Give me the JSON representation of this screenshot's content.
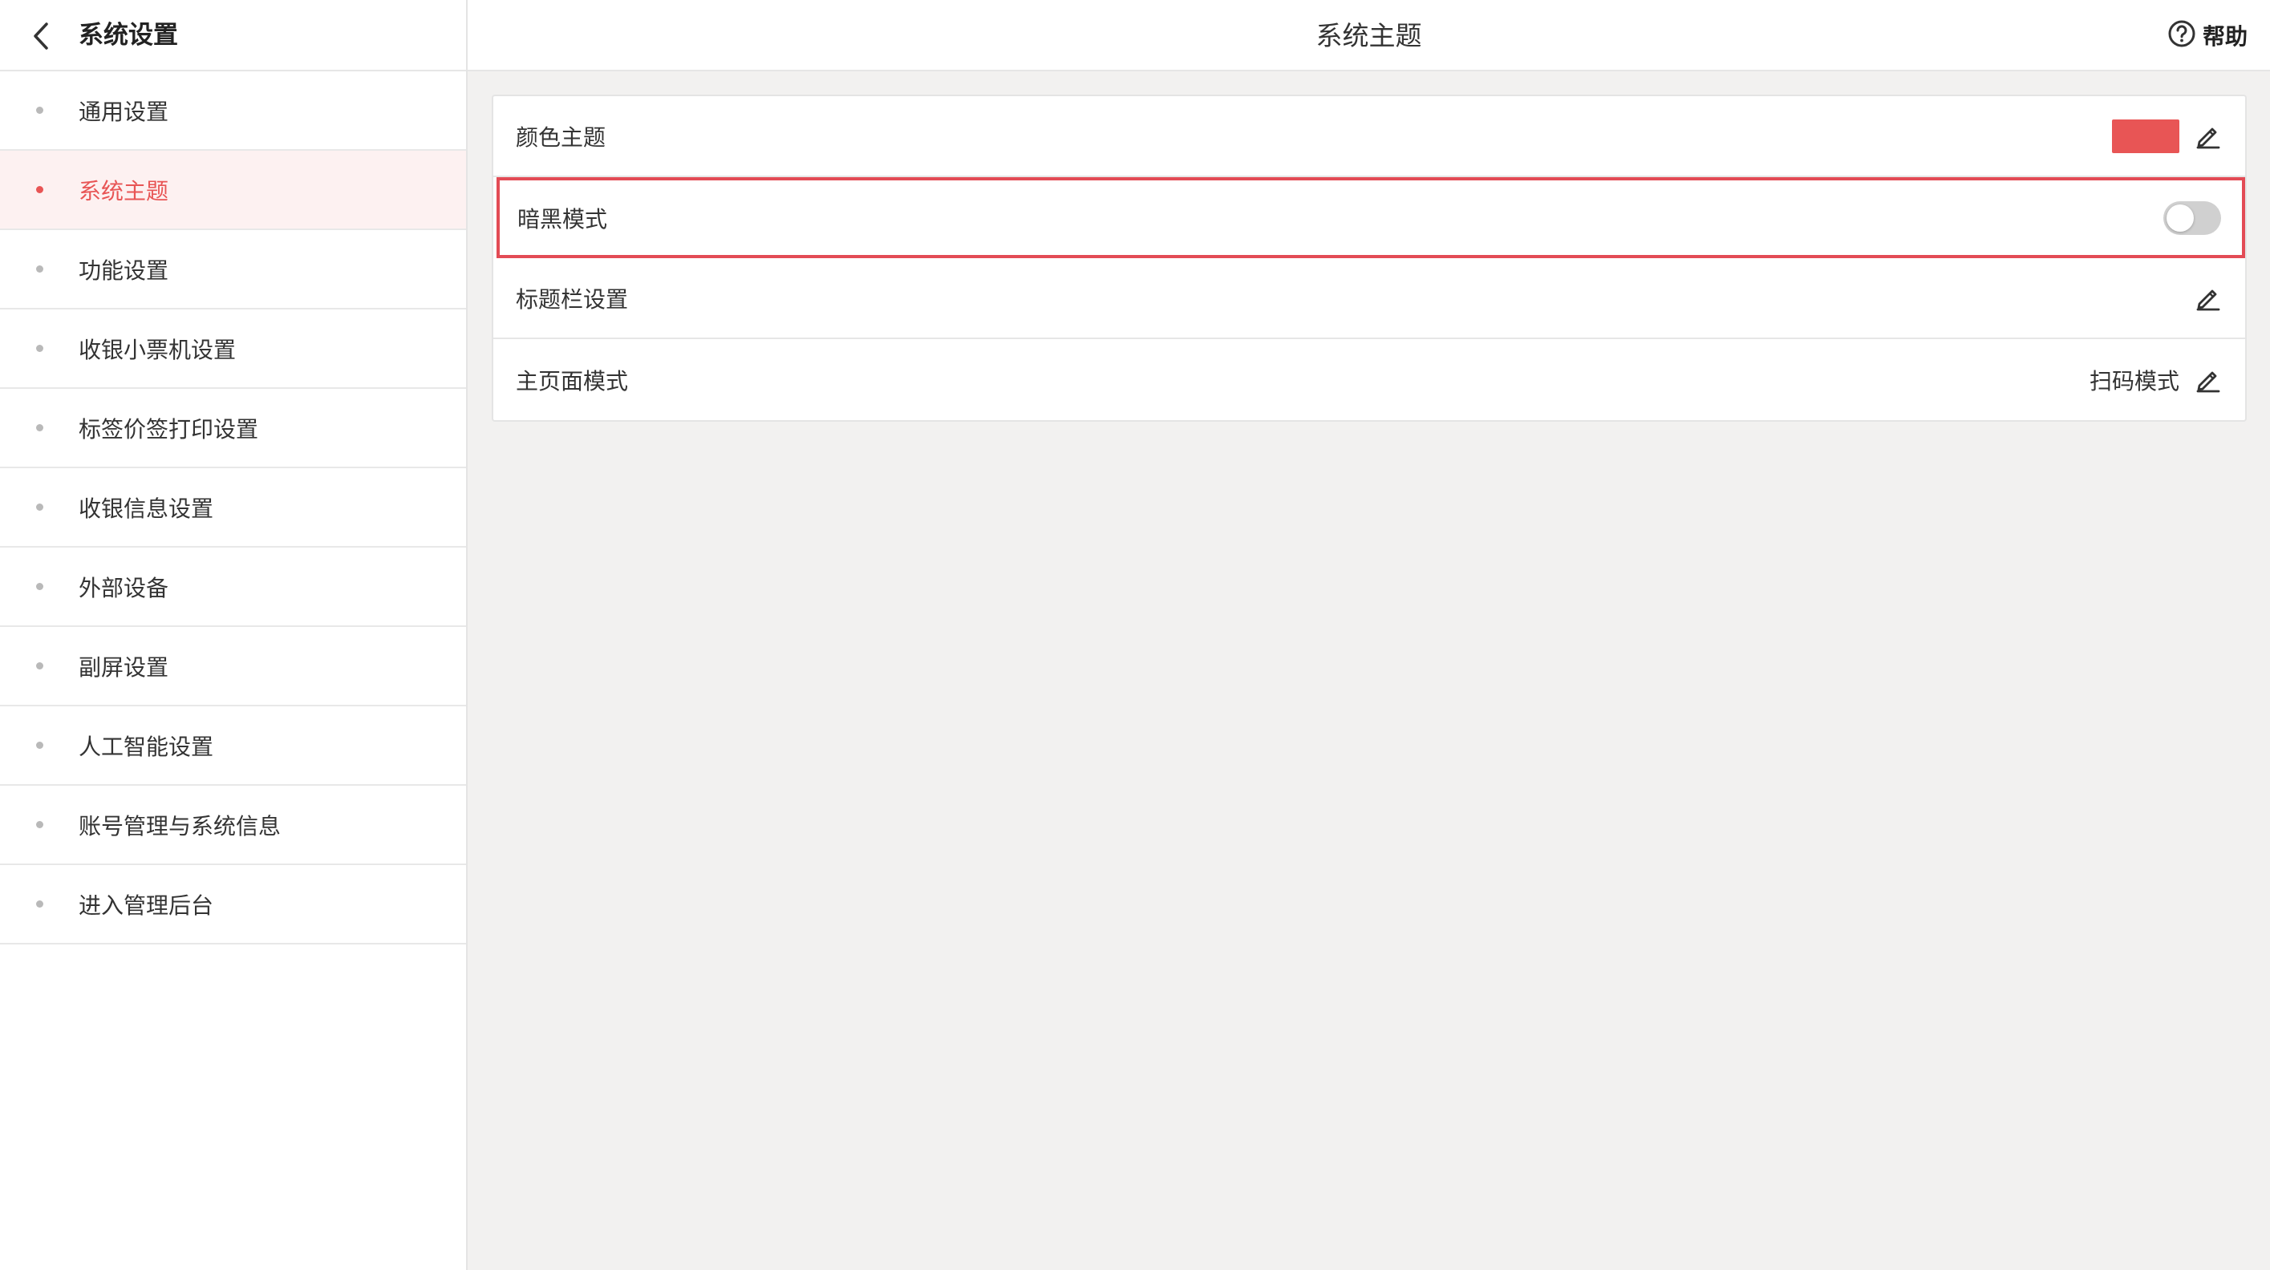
{
  "sidebar": {
    "title": "系统设置",
    "items": [
      {
        "label": "通用设置",
        "active": false
      },
      {
        "label": "系统主题",
        "active": true
      },
      {
        "label": "功能设置",
        "active": false
      },
      {
        "label": "收银小票机设置",
        "active": false
      },
      {
        "label": "标签价签打印设置",
        "active": false
      },
      {
        "label": "收银信息设置",
        "active": false
      },
      {
        "label": "外部设备",
        "active": false
      },
      {
        "label": "副屏设置",
        "active": false
      },
      {
        "label": "人工智能设置",
        "active": false
      },
      {
        "label": "账号管理与系统信息",
        "active": false
      },
      {
        "label": "进入管理后台",
        "active": false
      }
    ]
  },
  "header": {
    "title": "系统主题",
    "help_label": "帮助"
  },
  "settings": {
    "color_theme": {
      "label": "颜色主题",
      "swatch_color": "#e85555"
    },
    "dark_mode": {
      "label": "暗黑模式",
      "enabled": false
    },
    "titlebar": {
      "label": "标题栏设置"
    },
    "home_mode": {
      "label": "主页面模式",
      "value": "扫码模式"
    }
  },
  "colors": {
    "accent": "#e85555",
    "highlight_border": "#e34b55",
    "background": "#f2f1f0"
  }
}
